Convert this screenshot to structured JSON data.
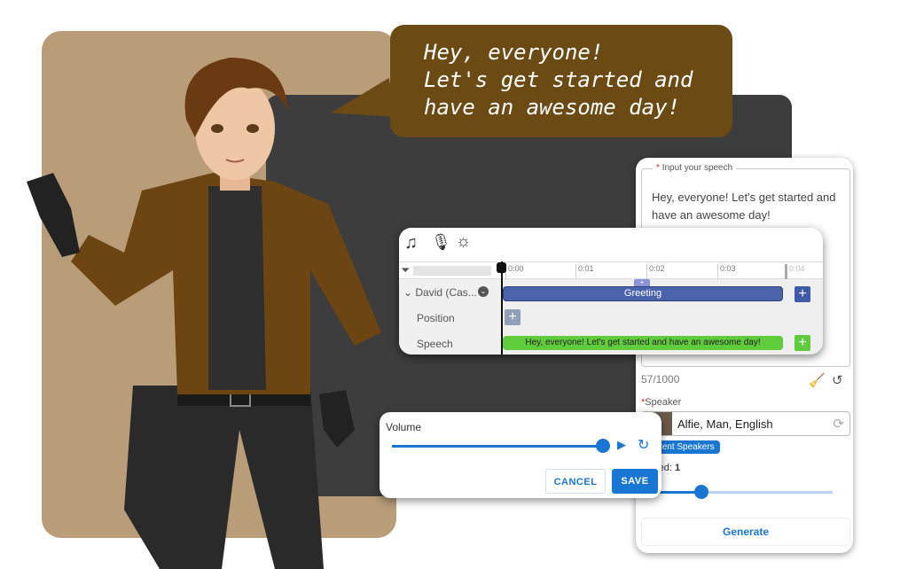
{
  "bubble": {
    "lines": [
      "Hey, everyone!",
      "Let's get started and",
      "have an awesome day!"
    ]
  },
  "speech_panel": {
    "input_label": "Input your speech",
    "required_mark": "*",
    "input_value": "Hey, everyone! Let's get started and have an awesome day!",
    "char_count": "57/1000",
    "speaker_label": "Speaker",
    "speaker_value": "Alfie, Man, English",
    "speakers_chip": "Different Speakers",
    "speed_label": "Speed:",
    "speed_value": "1",
    "speed_fraction": 0.3,
    "generate_label": "Generate"
  },
  "timeline": {
    "ticks": [
      "0:00",
      "0:01",
      "0:02",
      "0:03",
      "0:04"
    ],
    "track_name": "David (Cas...",
    "rows": [
      "Position",
      "Speech"
    ],
    "greeting_clip": "Greeting",
    "speech_clip": "Hey, everyone! Let's get started and have an awesome day!"
  },
  "volume": {
    "label": "Volume",
    "value_fraction": 1.0,
    "cancel": "CANCEL",
    "save": "SAVE"
  },
  "colors": {
    "accent": "#1976d2",
    "bubble": "#6b4a14",
    "greeting": "#4a63ab",
    "speech": "#5fcb3d"
  }
}
